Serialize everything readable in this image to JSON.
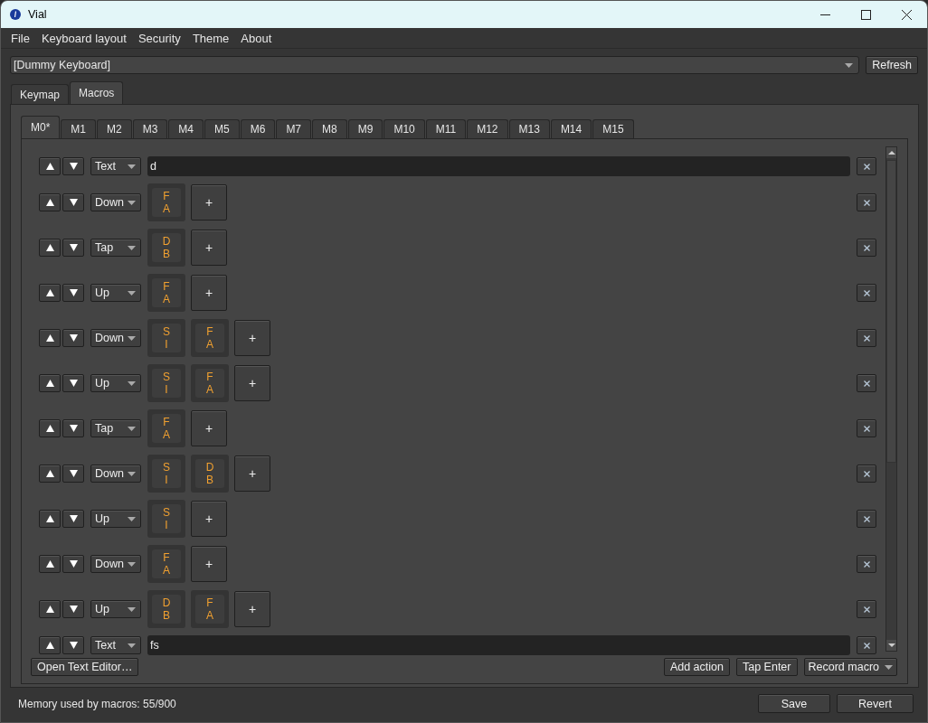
{
  "window": {
    "title": "Vial"
  },
  "menu": [
    "File",
    "Keyboard layout",
    "Security",
    "Theme",
    "About"
  ],
  "keyboard_select": {
    "value": "[Dummy Keyboard]"
  },
  "refresh_button": "Refresh",
  "tabs": [
    {
      "label": "Keymap",
      "selected": false
    },
    {
      "label": "Macros",
      "selected": true
    }
  ],
  "macro_tabs": [
    {
      "label": "M0*",
      "selected": true
    },
    {
      "label": "M1",
      "selected": false
    },
    {
      "label": "M2",
      "selected": false
    },
    {
      "label": "M3",
      "selected": false
    },
    {
      "label": "M4",
      "selected": false
    },
    {
      "label": "M5",
      "selected": false
    },
    {
      "label": "M6",
      "selected": false
    },
    {
      "label": "M7",
      "selected": false
    },
    {
      "label": "M8",
      "selected": false
    },
    {
      "label": "M9",
      "selected": false
    },
    {
      "label": "M10",
      "selected": false
    },
    {
      "label": "M11",
      "selected": false
    },
    {
      "label": "M12",
      "selected": false
    },
    {
      "label": "M13",
      "selected": false
    },
    {
      "label": "M14",
      "selected": false
    },
    {
      "label": "M15",
      "selected": false
    }
  ],
  "actions": [
    {
      "kind": "text",
      "type": "Text",
      "value": "d"
    },
    {
      "kind": "keys",
      "type": "Down",
      "keys": [
        [
          "F",
          "A"
        ]
      ],
      "add": "+"
    },
    {
      "kind": "keys",
      "type": "Tap",
      "keys": [
        [
          "D",
          "B"
        ]
      ],
      "add": "+"
    },
    {
      "kind": "keys",
      "type": "Up",
      "keys": [
        [
          "F",
          "A"
        ]
      ],
      "add": "+"
    },
    {
      "kind": "keys",
      "type": "Down",
      "keys": [
        [
          "S",
          "I"
        ],
        [
          "F",
          "A"
        ]
      ],
      "add": "+"
    },
    {
      "kind": "keys",
      "type": "Up",
      "keys": [
        [
          "S",
          "I"
        ],
        [
          "F",
          "A"
        ]
      ],
      "add": "+"
    },
    {
      "kind": "keys",
      "type": "Tap",
      "keys": [
        [
          "F",
          "A"
        ]
      ],
      "add": "+"
    },
    {
      "kind": "keys",
      "type": "Down",
      "keys": [
        [
          "S",
          "I"
        ],
        [
          "D",
          "B"
        ]
      ],
      "add": "+"
    },
    {
      "kind": "keys",
      "type": "Up",
      "keys": [
        [
          "S",
          "I"
        ]
      ],
      "add": "+"
    },
    {
      "kind": "keys",
      "type": "Down",
      "keys": [
        [
          "F",
          "A"
        ]
      ],
      "add": "+"
    },
    {
      "kind": "keys",
      "type": "Up",
      "keys": [
        [
          "D",
          "B"
        ],
        [
          "F",
          "A"
        ]
      ],
      "add": "+"
    },
    {
      "kind": "text",
      "type": "Text",
      "value": "fs"
    }
  ],
  "open_text_editor": "Open Text Editor…",
  "action_buttons": [
    "Add action",
    "Tap Enter"
  ],
  "record_macro": "Record macro",
  "memory": "Memory used by macros: 55/900",
  "save": "Save",
  "revert": "Revert"
}
